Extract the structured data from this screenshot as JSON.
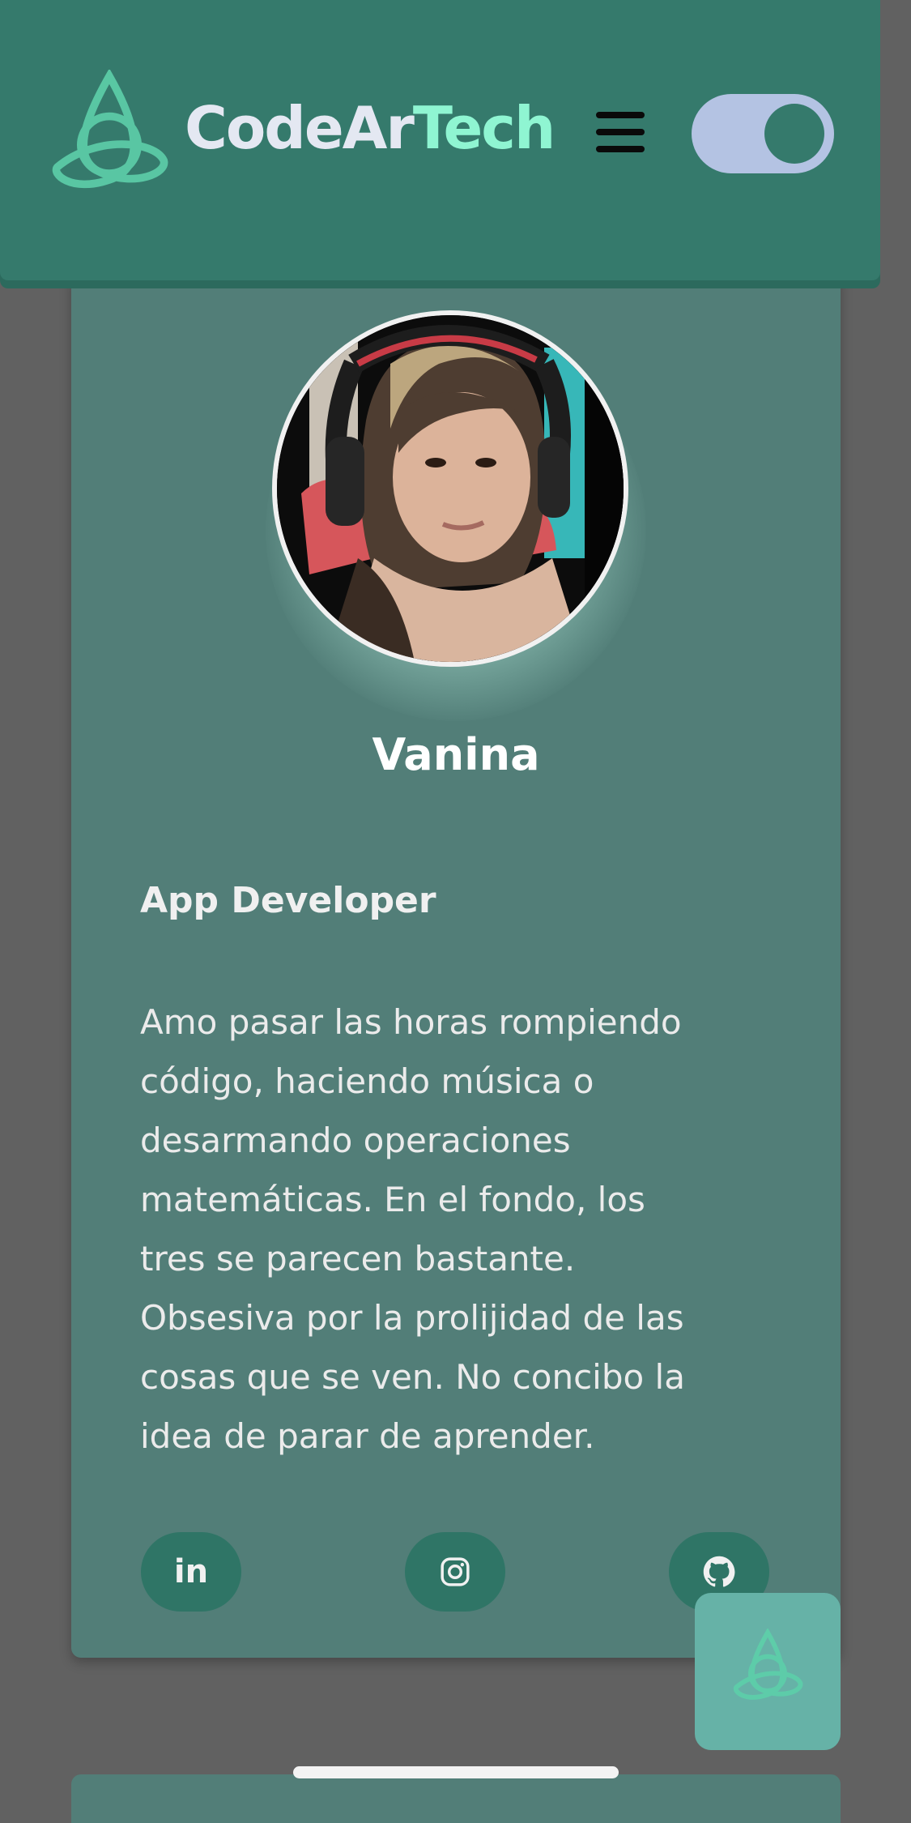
{
  "header": {
    "brand_part1": "CodeAr",
    "brand_part2": "Tech",
    "menu_icon": "hamburger-menu-icon",
    "theme_toggle": "dark-mode-toggle"
  },
  "profile": {
    "name": "Vanina",
    "role": "App Developer",
    "bio_lines": [
      "Amo pasar las horas rompiendo",
      "código, haciendo música o",
      "desarmando operaciones",
      "matemáticas. En el fondo, los",
      "tres se parecen bastante.",
      "Obsesiva por la prolijidad de las",
      "cosas que se ven. No concibo la",
      "idea de parar de aprender."
    ],
    "social": [
      {
        "icon": "linkedin-icon",
        "label": "in"
      },
      {
        "icon": "instagram-icon"
      },
      {
        "icon": "github-icon"
      }
    ]
  },
  "colors": {
    "header": "#357a6c",
    "card": "#527e78",
    "accent": "#8ff5d2",
    "background": "#616161"
  }
}
